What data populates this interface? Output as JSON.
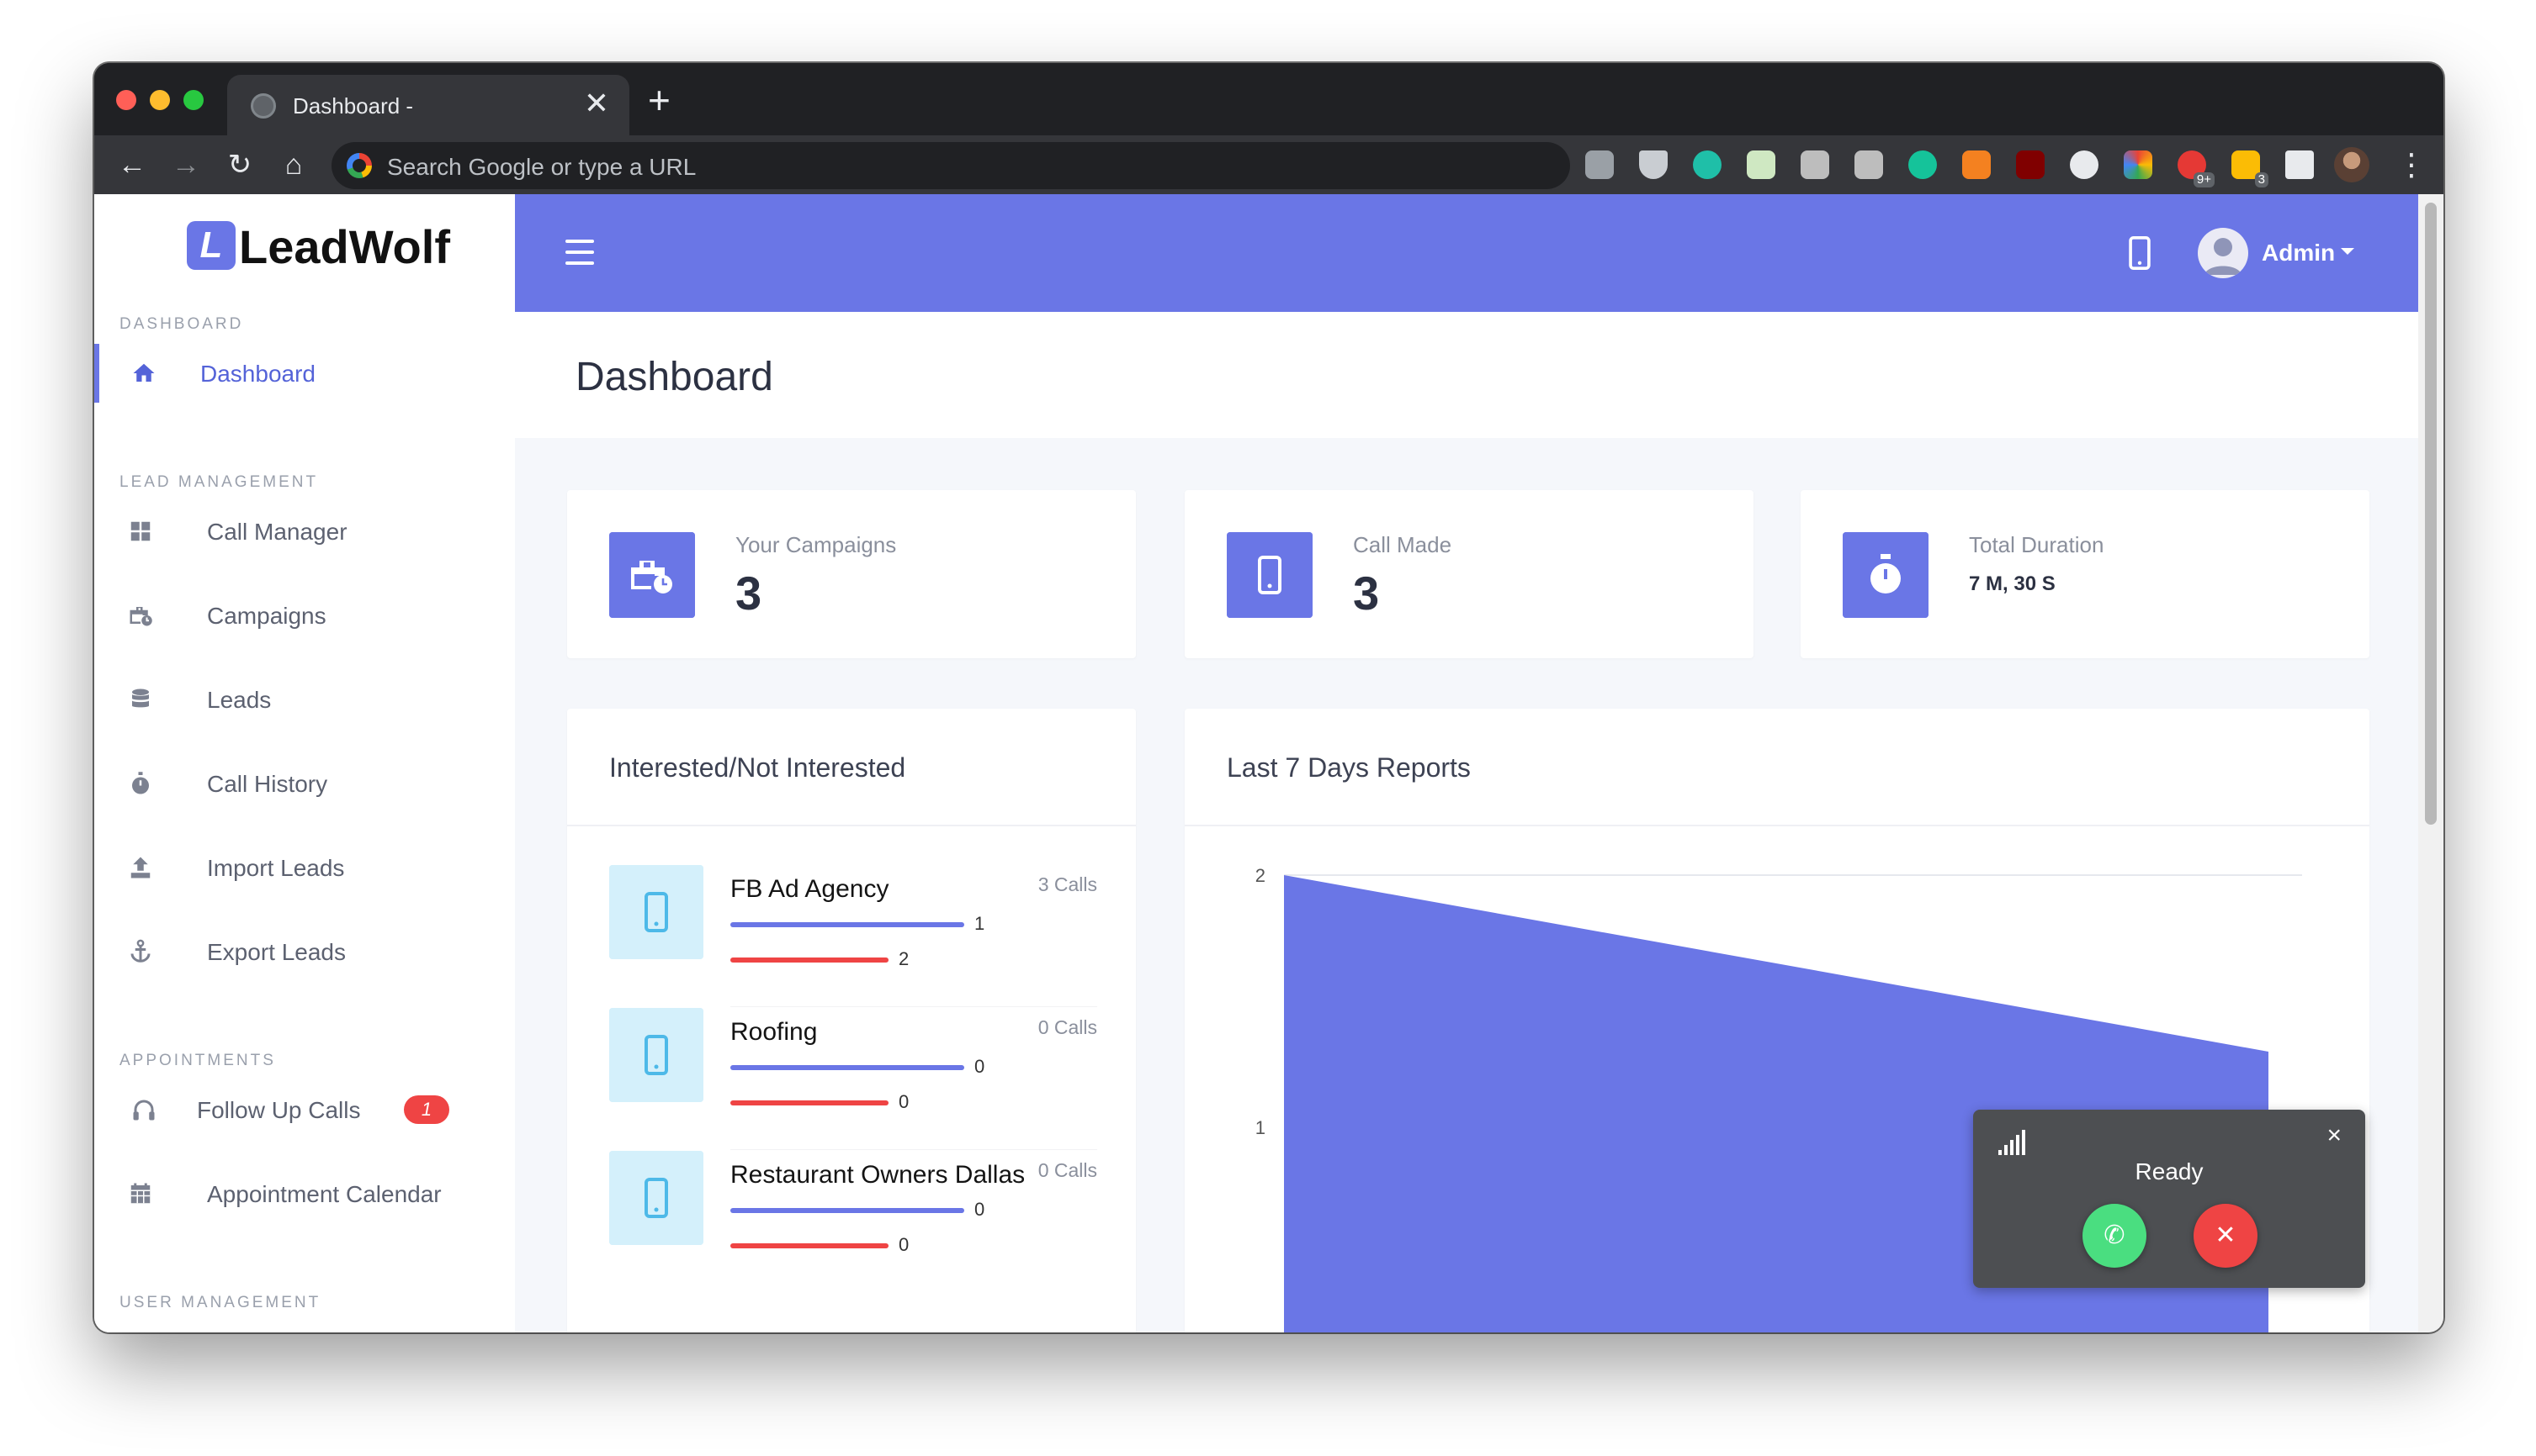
{
  "browser": {
    "tab_title": "Dashboard -",
    "tab_close": "✕",
    "new_tab": "+",
    "back": "←",
    "forward": "→",
    "reload": "↻",
    "home": "⌂",
    "omnibox_placeholder": "Search Google or type a URL",
    "menu": "⋮",
    "extension_badges": [
      "9+",
      "3"
    ]
  },
  "app": {
    "logo_letter": "L",
    "logo_text": "LeadWolf",
    "brand_color": "#6a76e6"
  },
  "sidebar": {
    "sections": [
      {
        "title": "DASHBOARD",
        "items": [
          {
            "label": "Dashboard",
            "icon": "home-icon",
            "active": true
          }
        ]
      },
      {
        "title": "LEAD MANAGEMENT",
        "items": [
          {
            "label": "Call Manager",
            "icon": "grid-icon"
          },
          {
            "label": "Campaigns",
            "icon": "briefcase-clock-icon"
          },
          {
            "label": "Leads",
            "icon": "database-icon"
          },
          {
            "label": "Call History",
            "icon": "stopwatch-icon"
          },
          {
            "label": "Import Leads",
            "icon": "upload-icon"
          },
          {
            "label": "Export Leads",
            "icon": "anchor-icon"
          }
        ]
      },
      {
        "title": "APPOINTMENTS",
        "items": [
          {
            "label": "Follow Up Calls",
            "icon": "headphones-icon",
            "badge": "1"
          },
          {
            "label": "Appointment Calendar",
            "icon": "calendar-icon"
          }
        ]
      },
      {
        "title": "USER MANAGEMENT",
        "items": []
      }
    ]
  },
  "topbar": {
    "user_name": "Admin"
  },
  "page": {
    "title": "Dashboard"
  },
  "stats": [
    {
      "label": "Your Campaigns",
      "value": "3",
      "icon": "briefcase-clock-icon"
    },
    {
      "label": "Call Made",
      "value": "3",
      "icon": "mobile-phone-icon"
    },
    {
      "label": "Total Duration",
      "value": "7 M, 30 S",
      "icon": "stopwatch-icon"
    }
  ],
  "interest_card": {
    "title": "Interested/Not Interested",
    "campaigns": [
      {
        "name": "FB Ad Agency",
        "calls": "3 Calls",
        "interested": "1",
        "not_interested": "2"
      },
      {
        "name": "Roofing",
        "calls": "0 Calls",
        "interested": "0",
        "not_interested": "0"
      },
      {
        "name": "Restaurant Owners Dallas",
        "calls": "0 Calls",
        "interested": "0",
        "not_interested": "0"
      }
    ]
  },
  "reports_card": {
    "title": "Last 7 Days Reports"
  },
  "chart_data": {
    "type": "area",
    "title": "Last 7 Days Reports",
    "y_ticks": [
      "2",
      "1"
    ],
    "ylim": [
      0,
      2
    ],
    "series": [
      {
        "color": "#6a76e6",
        "values": [
          2,
          1.3
        ]
      }
    ]
  },
  "dialer": {
    "status": "Ready",
    "close": "×",
    "answer_icon": "✆",
    "hangup_icon": "✕"
  }
}
